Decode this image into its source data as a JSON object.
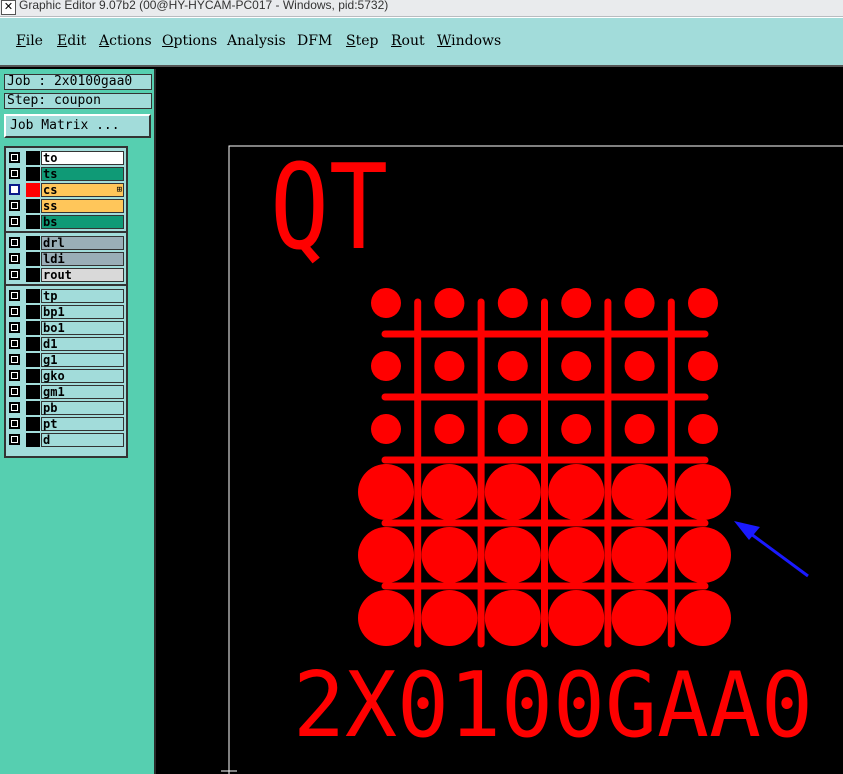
{
  "titlebar": {
    "title": "Graphic Editor 9.07b2 (00@HY-HYCAM-PC017 - Windows, pid:5732)"
  },
  "menu": [
    {
      "label": "File",
      "underline": "F",
      "rest": "ile"
    },
    {
      "label": "Edit",
      "underline": "E",
      "rest": "dit"
    },
    {
      "label": "Actions",
      "underline": "A",
      "rest": "ctions"
    },
    {
      "label": "Options",
      "underline": "O",
      "rest": "ptions"
    },
    {
      "label": "Analysis",
      "underline": "",
      "rest": "Analysis"
    },
    {
      "label": "DFM",
      "underline": "",
      "rest": "DFM"
    },
    {
      "label": "Step",
      "underline": "S",
      "rest": "tep"
    },
    {
      "label": "Rout",
      "underline": "R",
      "rest": "out"
    },
    {
      "label": "Windows",
      "underline": "W",
      "rest": "indows"
    }
  ],
  "job": {
    "job_label": "Job : 2x0100gaa0",
    "step_label": "Step: coupon",
    "matrix_button": "Job Matrix ..."
  },
  "layers": {
    "group1": [
      {
        "name": "to",
        "color": "#ffffff",
        "active": false,
        "swatch": "black"
      },
      {
        "name": "ts",
        "color": "#0f9a76",
        "active": false,
        "swatch": "black"
      },
      {
        "name": "cs",
        "color": "#ffc65a",
        "active": true,
        "swatch": "red",
        "marker": "⊞"
      },
      {
        "name": "ss",
        "color": "#ffc65a",
        "active": false,
        "swatch": "black"
      },
      {
        "name": "bs",
        "color": "#0f9a76",
        "active": false,
        "swatch": "black"
      }
    ],
    "group2": [
      {
        "name": "drl",
        "color": "#9aaeb7",
        "active": false,
        "swatch": "black"
      },
      {
        "name": "ldi",
        "color": "#9aaeb7",
        "active": false,
        "swatch": "black"
      },
      {
        "name": "rout",
        "color": "#d9d9d9",
        "active": false,
        "swatch": "black"
      }
    ],
    "group3": [
      {
        "name": "tp",
        "color": "#a2dcda",
        "active": false,
        "swatch": "black"
      },
      {
        "name": "bp1",
        "color": "#a2dcda",
        "active": false,
        "swatch": "black"
      },
      {
        "name": "bo1",
        "color": "#a2dcda",
        "active": false,
        "swatch": "black"
      },
      {
        "name": "d1",
        "color": "#a2dcda",
        "active": false,
        "swatch": "black"
      },
      {
        "name": "g1",
        "color": "#a2dcda",
        "active": false,
        "swatch": "black"
      },
      {
        "name": "gko",
        "color": "#a2dcda",
        "active": false,
        "swatch": "black"
      },
      {
        "name": "gm1",
        "color": "#a2dcda",
        "active": false,
        "swatch": "black"
      },
      {
        "name": "pb",
        "color": "#a2dcda",
        "active": false,
        "swatch": "black"
      },
      {
        "name": "pt",
        "color": "#a2dcda",
        "active": false,
        "swatch": "black"
      },
      {
        "name": "d",
        "color": "#a2dcda",
        "active": false,
        "swatch": "black"
      }
    ]
  },
  "canvas": {
    "top_text": "QT",
    "bottom_text": "2X0100GAA0",
    "feature_color": "#ff0000",
    "annotation_arrow_color": "#1a1aff",
    "grid_columns": 6,
    "small_pad_rows": 3,
    "large_pad_rows": 3
  },
  "colors": {
    "menubar_bg": "#a2dcda",
    "panel_bg": "#56cfb0",
    "canvas_bg": "#000000"
  }
}
